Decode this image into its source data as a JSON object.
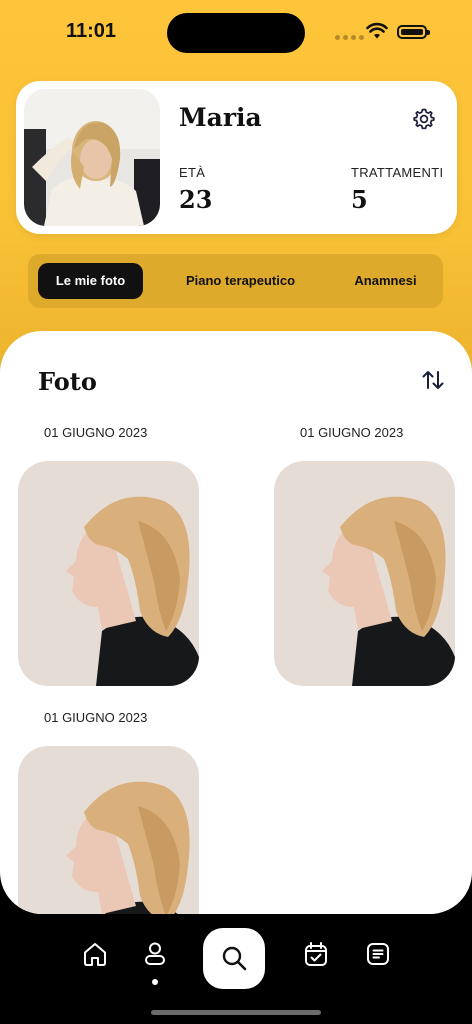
{
  "status_bar": {
    "time": "11:01"
  },
  "profile": {
    "name": "Maria",
    "age_label": "ETÀ",
    "age_value": "23",
    "treatments_label": "TRATTAMENTI",
    "treatments_value": "5",
    "settings_icon": "gear-icon"
  },
  "tabs": [
    {
      "label": "Le mie foto",
      "active": true
    },
    {
      "label": "Piano terapeutico",
      "active": false
    },
    {
      "label": "Anamnesi",
      "active": false
    }
  ],
  "photos_section": {
    "title": "Foto",
    "sort_icon": "sort-arrows-icon",
    "items": [
      {
        "date": "01 GIUGNO 2023"
      },
      {
        "date": "01 GIUGNO 2023"
      },
      {
        "date": "01 GIUGNO 2023"
      }
    ]
  },
  "bottom_nav": {
    "items": [
      "home-icon",
      "profile-icon",
      "search-icon",
      "calendar-check-icon",
      "notes-icon"
    ],
    "active": "profile-icon"
  },
  "colors": {
    "accent": "#fec43a",
    "tab_bg": "#deaa2b",
    "dark": "#111111"
  }
}
